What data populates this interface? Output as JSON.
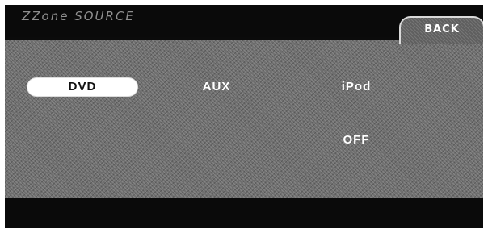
{
  "header": {
    "title": "ZZone SOURCE",
    "back_label": "BACK"
  },
  "sources": {
    "dvd": "DVD",
    "aux": "AUX",
    "ipod": "iPod",
    "off": "OFF",
    "selected": "DVD"
  },
  "colors": {
    "background": "#0b0b0b",
    "panel": "#6f6f6f",
    "selected_fill": "#ffffff",
    "text": "#ffffff",
    "title_text": "#8f8f8f"
  }
}
